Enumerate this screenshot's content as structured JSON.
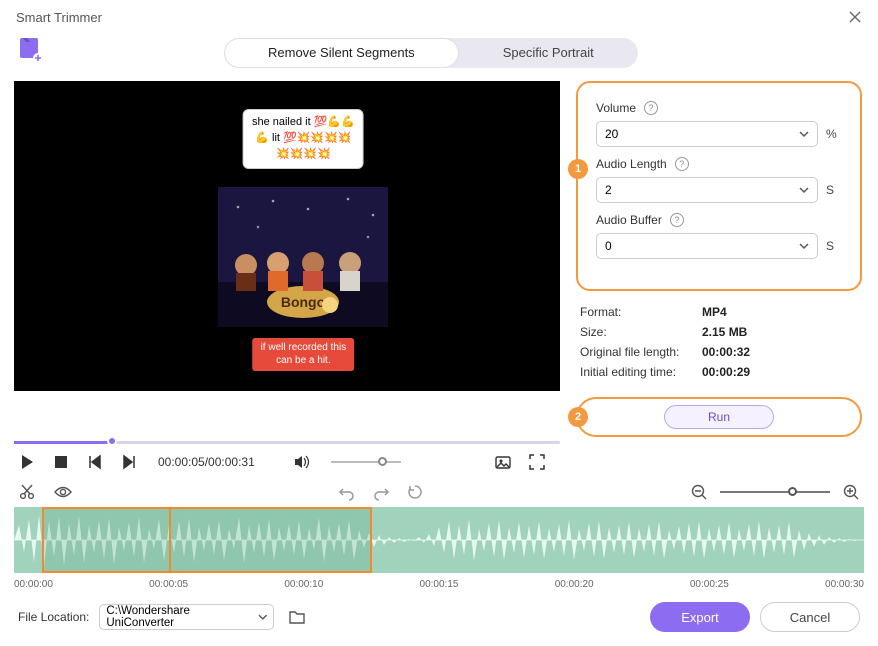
{
  "window": {
    "title": "Smart Trimmer"
  },
  "tabs": {
    "remove": "Remove Silent Segments",
    "portrait": "Specific Portrait"
  },
  "overlay": {
    "bubble_line1": "she nailed it 💯💪💪",
    "bubble_line2": "💪 lit 💯💥💥💥💥",
    "bubble_line3": "💥💥💥💥",
    "caption_line1": "if well recorded this",
    "caption_line2": "can be a hit."
  },
  "params": {
    "volume_label": "Volume",
    "volume_value": "20",
    "volume_unit": "%",
    "length_label": "Audio Length",
    "length_value": "2",
    "length_unit": "S",
    "buffer_label": "Audio Buffer",
    "buffer_value": "0",
    "buffer_unit": "S"
  },
  "badges": {
    "one": "1",
    "two": "2"
  },
  "meta": {
    "format_k": "Format:",
    "format_v": "MP4",
    "size_k": "Size:",
    "size_v": "2.15 MB",
    "orig_k": "Original file length:",
    "orig_v": "00:00:32",
    "init_k": "Initial editing time:",
    "init_v": "00:00:29"
  },
  "run": "Run",
  "transport": {
    "tc": "00:00:05/00:00:31"
  },
  "ticks": [
    "00:00:00",
    "00:00:05",
    "00:00:10",
    "00:00:15",
    "00:00:20",
    "00:00:25",
    "00:00:30"
  ],
  "footer": {
    "label": "File Location:",
    "path": "C:\\Wondershare UniConverter",
    "export": "Export",
    "cancel": "Cancel"
  }
}
